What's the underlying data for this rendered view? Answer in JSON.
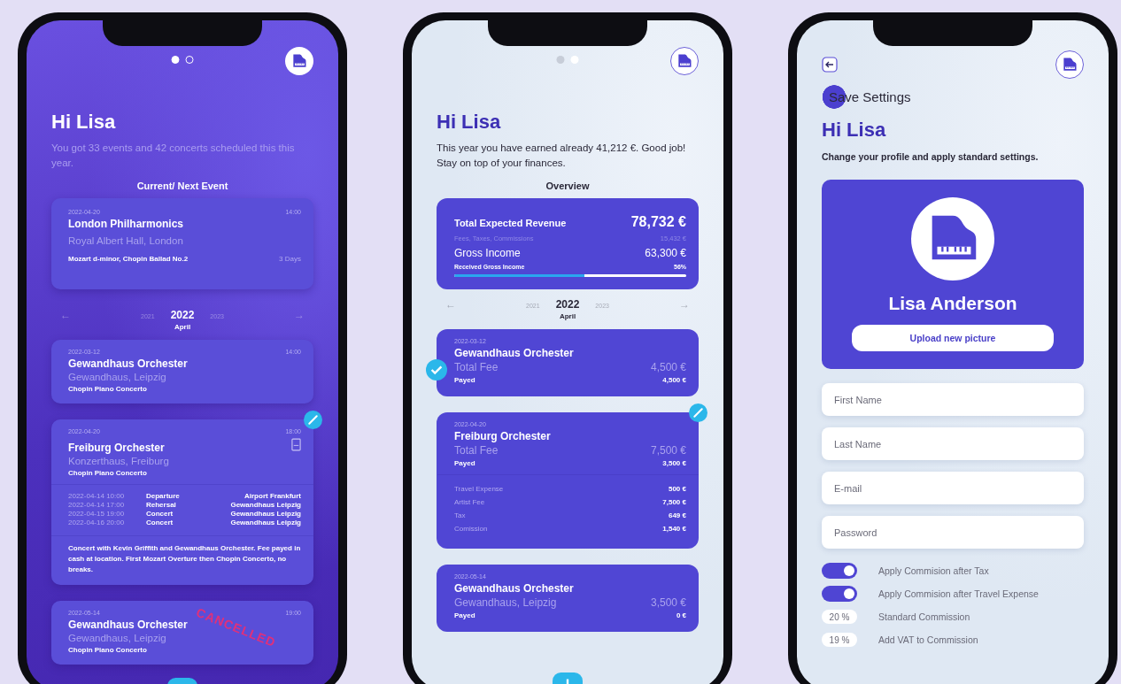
{
  "events_screen": {
    "pager": [
      {
        "selected": true
      },
      {
        "selected": false
      }
    ],
    "greeting": "Hi Lisa",
    "intro": "You got 33 events and 42 concerts scheduled this this year.",
    "section_title": "Current/ Next Event",
    "current_event": {
      "date": "2022-04-20",
      "time": "14:00",
      "title": "London Philharmonics",
      "venue": "Royal Albert Hall, London",
      "program": "Mozart d-minor, Chopin Ballad No.2",
      "countdown": "3 Days"
    },
    "year_nav": {
      "prev": "←",
      "years": [
        {
          "label": "2021",
          "selected": false
        },
        {
          "label": "2022",
          "selected": true
        },
        {
          "label": "2023",
          "selected": false
        }
      ],
      "next": "→",
      "month": "April"
    },
    "events": [
      {
        "date": "2022-03-12",
        "time": "14:00",
        "title": "Gewandhaus Orchester",
        "venue": "Gewandhaus, Leipzig",
        "program": "Chopin Piano Concerto",
        "edit_badge": false,
        "attachment": false
      },
      {
        "date": "2022-04-20",
        "time": "18:00",
        "title": "Freiburg Orchester",
        "venue": "Konzerthaus, Freiburg",
        "program": "Chopin Piano Concerto",
        "edit_badge": true,
        "attachment": true,
        "schedule": [
          {
            "when": "2022-04-14 10:00",
            "what": "Departure",
            "where": "Airport Frankfurt"
          },
          {
            "when": "2022-04-14 17:00",
            "what": "Rehersal",
            "where": "Gewandhaus Leipzig"
          },
          {
            "when": "2022-04-15 19:00",
            "what": "Concert",
            "where": "Gewandhaus Leipzig"
          },
          {
            "when": "2022-04-16 20:00",
            "what": "Concert",
            "where": "Gewandhaus Leipzig"
          }
        ],
        "note": "Concert with Kevin Griffith and Gewandhaus Orchester. Fee payed in cash at location. First Mozart Overture then Chopin Concerto, no breaks."
      },
      {
        "date": "2022-05-14",
        "time": "19:00",
        "title": "Gewandhaus Orchester",
        "venue": "Gewandhaus, Leipzig",
        "program": "Chopin Piano Concerto",
        "edit_badge": false,
        "attachment": false,
        "stamp": "CANCELLED"
      }
    ]
  },
  "finance_screen": {
    "pager": [
      {
        "selected": false
      },
      {
        "selected": true
      }
    ],
    "greeting": "Hi Lisa",
    "intro": "This year you have earned already 41,212 €. Good job! Stay on top of your finances.",
    "section_title": "Overview",
    "overview": {
      "total_label": "Total Expected Revenue",
      "total": "78,732 €",
      "deductions_label": "Fees, Taxes, Commissions",
      "deductions": "15,432 €",
      "gross_label": "Gross Income",
      "gross": "63,300 €",
      "progress_label": "Received Gross Income",
      "progress_reading": "56%",
      "level": 0.56
    },
    "year_nav": {
      "prev": "←",
      "years": [
        {
          "label": "2021",
          "selected": false
        },
        {
          "label": "2022",
          "selected": true
        },
        {
          "label": "2023",
          "selected": false
        }
      ],
      "next": "→",
      "month": "April"
    },
    "cards": [
      {
        "date": "2022-03-12",
        "title": "Gewandhaus Orchester",
        "fee_label": "Total Fee",
        "fee": "4,500 €",
        "paid_label": "Payed",
        "paid": "4,500 €",
        "settled": true,
        "edit_badge": false
      },
      {
        "date": "2022-04-20",
        "title": "Freiburg Orchester",
        "fee_label": "Total Fee",
        "fee": "7,500 €",
        "paid_label": "Payed",
        "paid": "3,500 €",
        "settled": false,
        "edit_badge": true,
        "breakdown": [
          {
            "label": "Travel Expense",
            "amount": "500 €"
          },
          {
            "label": "Artist Fee",
            "amount": "7,500 €"
          },
          {
            "label": "Tax",
            "amount": "649 €"
          },
          {
            "label": "Comission",
            "amount": "1,540 €"
          }
        ]
      },
      {
        "date": "2022-05-14",
        "title": "Gewandhaus Orchester",
        "fee_label": "Gewandhaus, Leipzig",
        "fee": "3,500 €",
        "paid_label": "Payed",
        "paid": "0 €",
        "settled": false,
        "edit_badge": false
      }
    ]
  },
  "settings_screen": {
    "save_button": "Save Settings",
    "greeting": "Hi Lisa",
    "intro": "Change your profile and apply standard settings.",
    "profile_name": "Lisa Anderson",
    "upload_button": "Upload new picture",
    "fields": [
      {
        "placeholder": "First Name"
      },
      {
        "placeholder": "Last Name"
      },
      {
        "placeholder": "E-mail"
      },
      {
        "placeholder": "Password"
      }
    ],
    "options": [
      {
        "kind": "toggle",
        "label": "Apply Commision after Tax",
        "on": true
      },
      {
        "kind": "toggle",
        "label": "Apply Commision after Travel Expense",
        "on": true
      },
      {
        "kind": "percent",
        "value": "20 %",
        "label": "Standard Commission"
      },
      {
        "kind": "percent",
        "value": "19 %",
        "label": "Add VAT to Commission"
      }
    ]
  }
}
